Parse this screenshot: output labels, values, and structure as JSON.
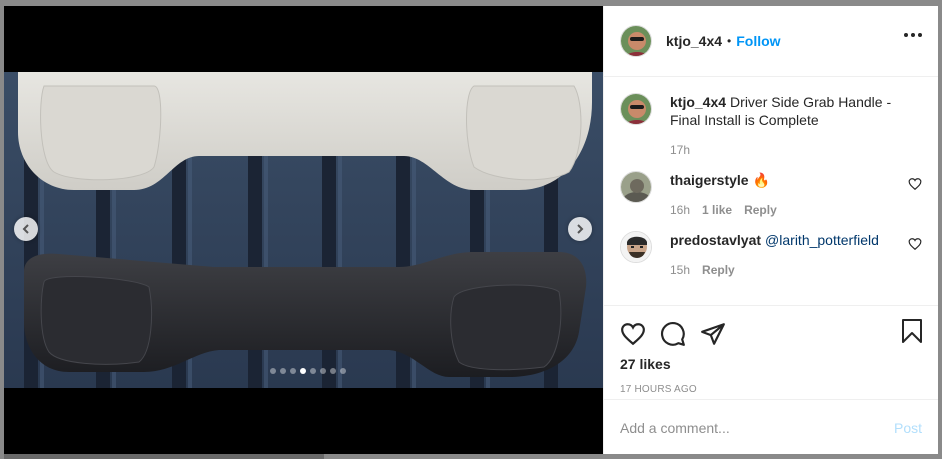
{
  "post": {
    "username": "ktjo_4x4",
    "separator": "•",
    "follow_label": "Follow"
  },
  "caption": {
    "username": "ktjo_4x4",
    "text": "Driver Side Grab Handle - Final Install is Complete",
    "time": "17h"
  },
  "comments": [
    {
      "username": "thaigerstyle",
      "text": "🔥",
      "time": "16h",
      "likes": "1 like",
      "reply": "Reply"
    },
    {
      "username": "predostavlyat",
      "text": "@larith_potterfield",
      "time": "15h",
      "likes": "",
      "reply": "Reply"
    }
  ],
  "actions": {
    "likes": "27 likes",
    "time_ago": "17 HOURS AGO"
  },
  "add_comment": {
    "placeholder": "Add a comment...",
    "post_label": "Post"
  },
  "carousel": {
    "count": 8,
    "active_index": 3
  },
  "colors": {
    "accent": "#0095f6",
    "post_disabled": "#b2dffc",
    "meta": "#8e8e8e"
  }
}
